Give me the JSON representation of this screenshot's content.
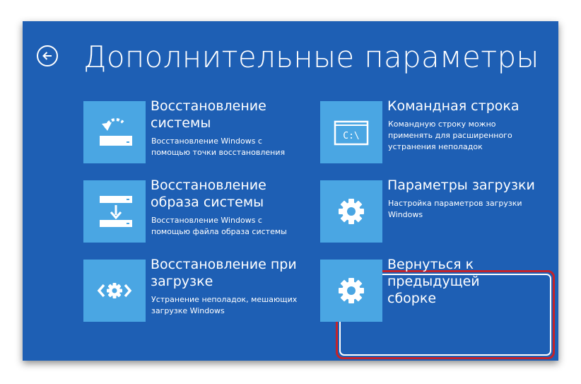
{
  "header": {
    "title": "Дополнительные параметры",
    "back_icon": "back-arrow-icon"
  },
  "options": [
    {
      "title": "Восстановление системы",
      "description": "Восстановление Windows с помощью точки восстановления",
      "icon": "system-restore-icon"
    },
    {
      "title": "Командная строка",
      "description": "Командную строку можно применять для расширенного устранения неполадок",
      "icon": "command-prompt-icon",
      "icon_text": "C:\\"
    },
    {
      "title": "Восстановление образа системы",
      "description": "Восстановление Windows с помощью файла образа системы",
      "icon": "system-image-recovery-icon"
    },
    {
      "title": "Параметры загрузки",
      "description": "Настройка параметров загрузки Windows",
      "icon": "gear-icon"
    },
    {
      "title": "Восстановление при загрузке",
      "description": "Устранение неполадок, мешающих загрузке Windows",
      "icon": "startup-repair-icon"
    },
    {
      "title": "Вернуться к предыдущей сборке",
      "description": "",
      "icon": "gear-icon",
      "highlighted": true
    }
  ],
  "colors": {
    "background": "#1e5fb4",
    "tile": "#4aa6e3",
    "highlight_border": "#c4232a"
  }
}
